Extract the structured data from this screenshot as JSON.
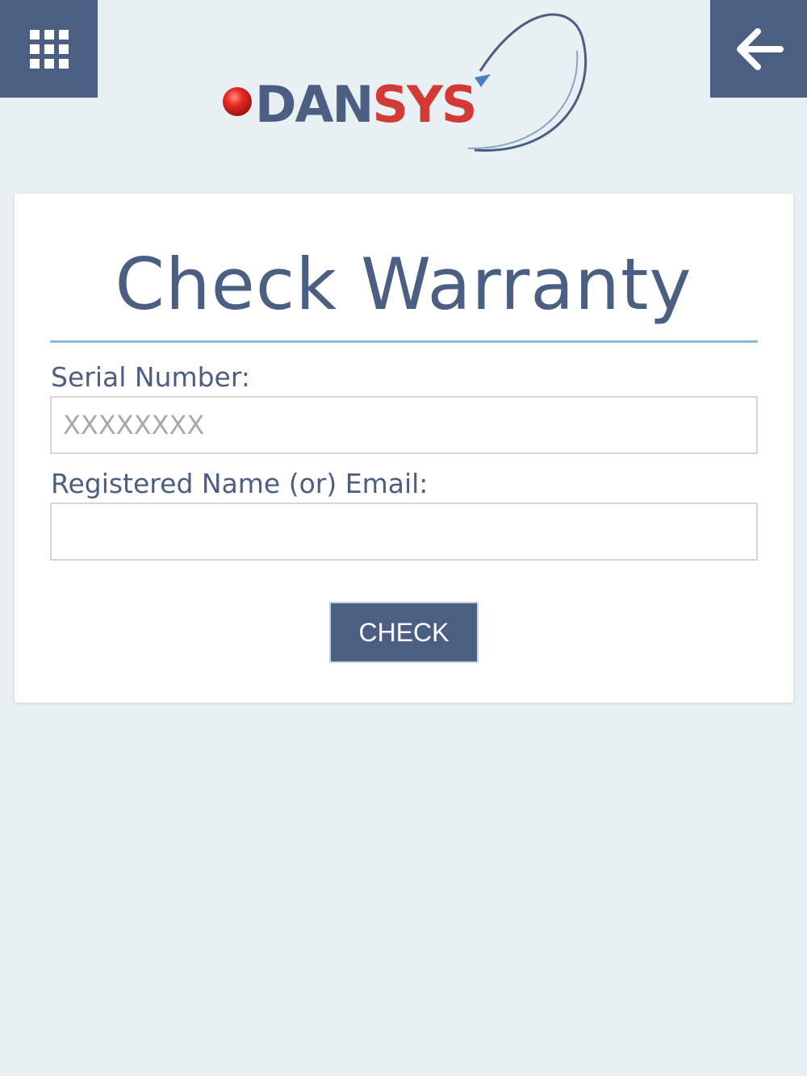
{
  "header": {
    "menu_icon": "grid-icon",
    "back_icon": "arrow-left-icon",
    "logo_text": "DANSYS"
  },
  "form": {
    "title": "Check Warranty",
    "serial_label": "Serial Number:",
    "serial_placeholder": "XXXXXXXX",
    "serial_value": "",
    "name_label": "Registered Name (or) Email:",
    "name_placeholder": "",
    "name_value": "",
    "submit_label": "CHECK"
  },
  "colors": {
    "brand_blue": "#4a5f82",
    "brand_red": "#d33a35",
    "background": "#e8f0f4",
    "rule": "#8db8dc"
  }
}
